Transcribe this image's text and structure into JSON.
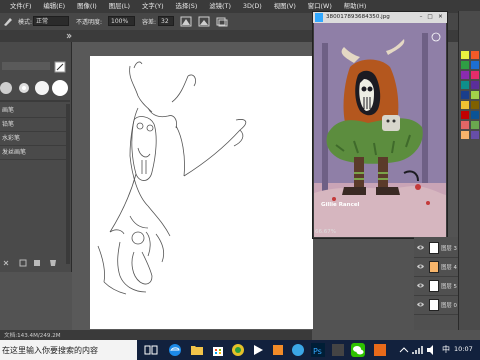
{
  "menu": {
    "items": [
      "文件(F)",
      "编辑(E)",
      "图像(I)",
      "图层(L)",
      "文字(Y)",
      "选择(S)",
      "滤镜(T)",
      "3D(D)",
      "视图(V)",
      "窗口(W)",
      "帮助(H)"
    ]
  },
  "options": {
    "mode_label": "模式:",
    "mode_value": "正常",
    "opacity_label": "不透明度:",
    "opacity_value": "100%",
    "flow_label": "容差:",
    "flow_value": "32"
  },
  "brushes": {
    "items": [
      "画笔",
      "铅笔",
      "水彩笔",
      "发丝画笔"
    ]
  },
  "image_window": {
    "title": "380017893684350.jpg",
    "zoom": "66.67%",
    "artist_signature": "Gillie Rancel"
  },
  "status": {
    "doc_size": "文档:143.4M/249.2M"
  },
  "layers": [
    {
      "name": "图层 3",
      "visible": true
    },
    {
      "name": "图层 4",
      "visible": true
    },
    {
      "name": "图层 5",
      "visible": true
    },
    {
      "name": "图层 0",
      "visible": true
    }
  ],
  "taskbar": {
    "search_placeholder": "在这里输入你要搜索的内容",
    "ime": "中",
    "clock_time": "10:07"
  },
  "colors": {
    "accent": "#31a8ff",
    "menubar": "#3a3a3a",
    "canvas_bg": "#595959"
  }
}
